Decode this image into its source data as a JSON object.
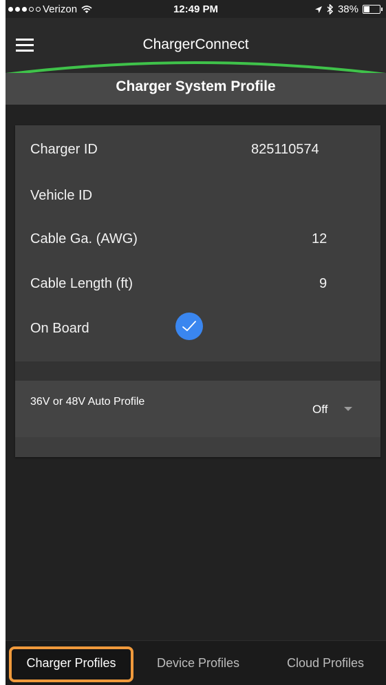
{
  "status_bar": {
    "carrier": "Verizon",
    "time": "12:49 PM",
    "battery": "38%",
    "battery_level": 0.38
  },
  "header": {
    "app_title": "ChargerConnect",
    "page_title": "Charger System Profile",
    "accent_color": "#3fc24a"
  },
  "profile": {
    "rows": [
      {
        "label": "Charger ID",
        "value": "825110574"
      },
      {
        "label": "Vehicle ID",
        "value": ""
      },
      {
        "label": "Cable Ga. (AWG)",
        "value": "12"
      },
      {
        "label": "Cable Length (ft)",
        "value": "9"
      },
      {
        "label": "On Board",
        "checked": true
      }
    ],
    "auto_profile": {
      "label": "36V or 48V Auto Profile",
      "value": "Off"
    }
  },
  "tabs": [
    {
      "label": "Charger Profiles",
      "active": true
    },
    {
      "label": "Device Profiles",
      "active": false
    },
    {
      "label": "Cloud Profiles",
      "active": false
    }
  ]
}
